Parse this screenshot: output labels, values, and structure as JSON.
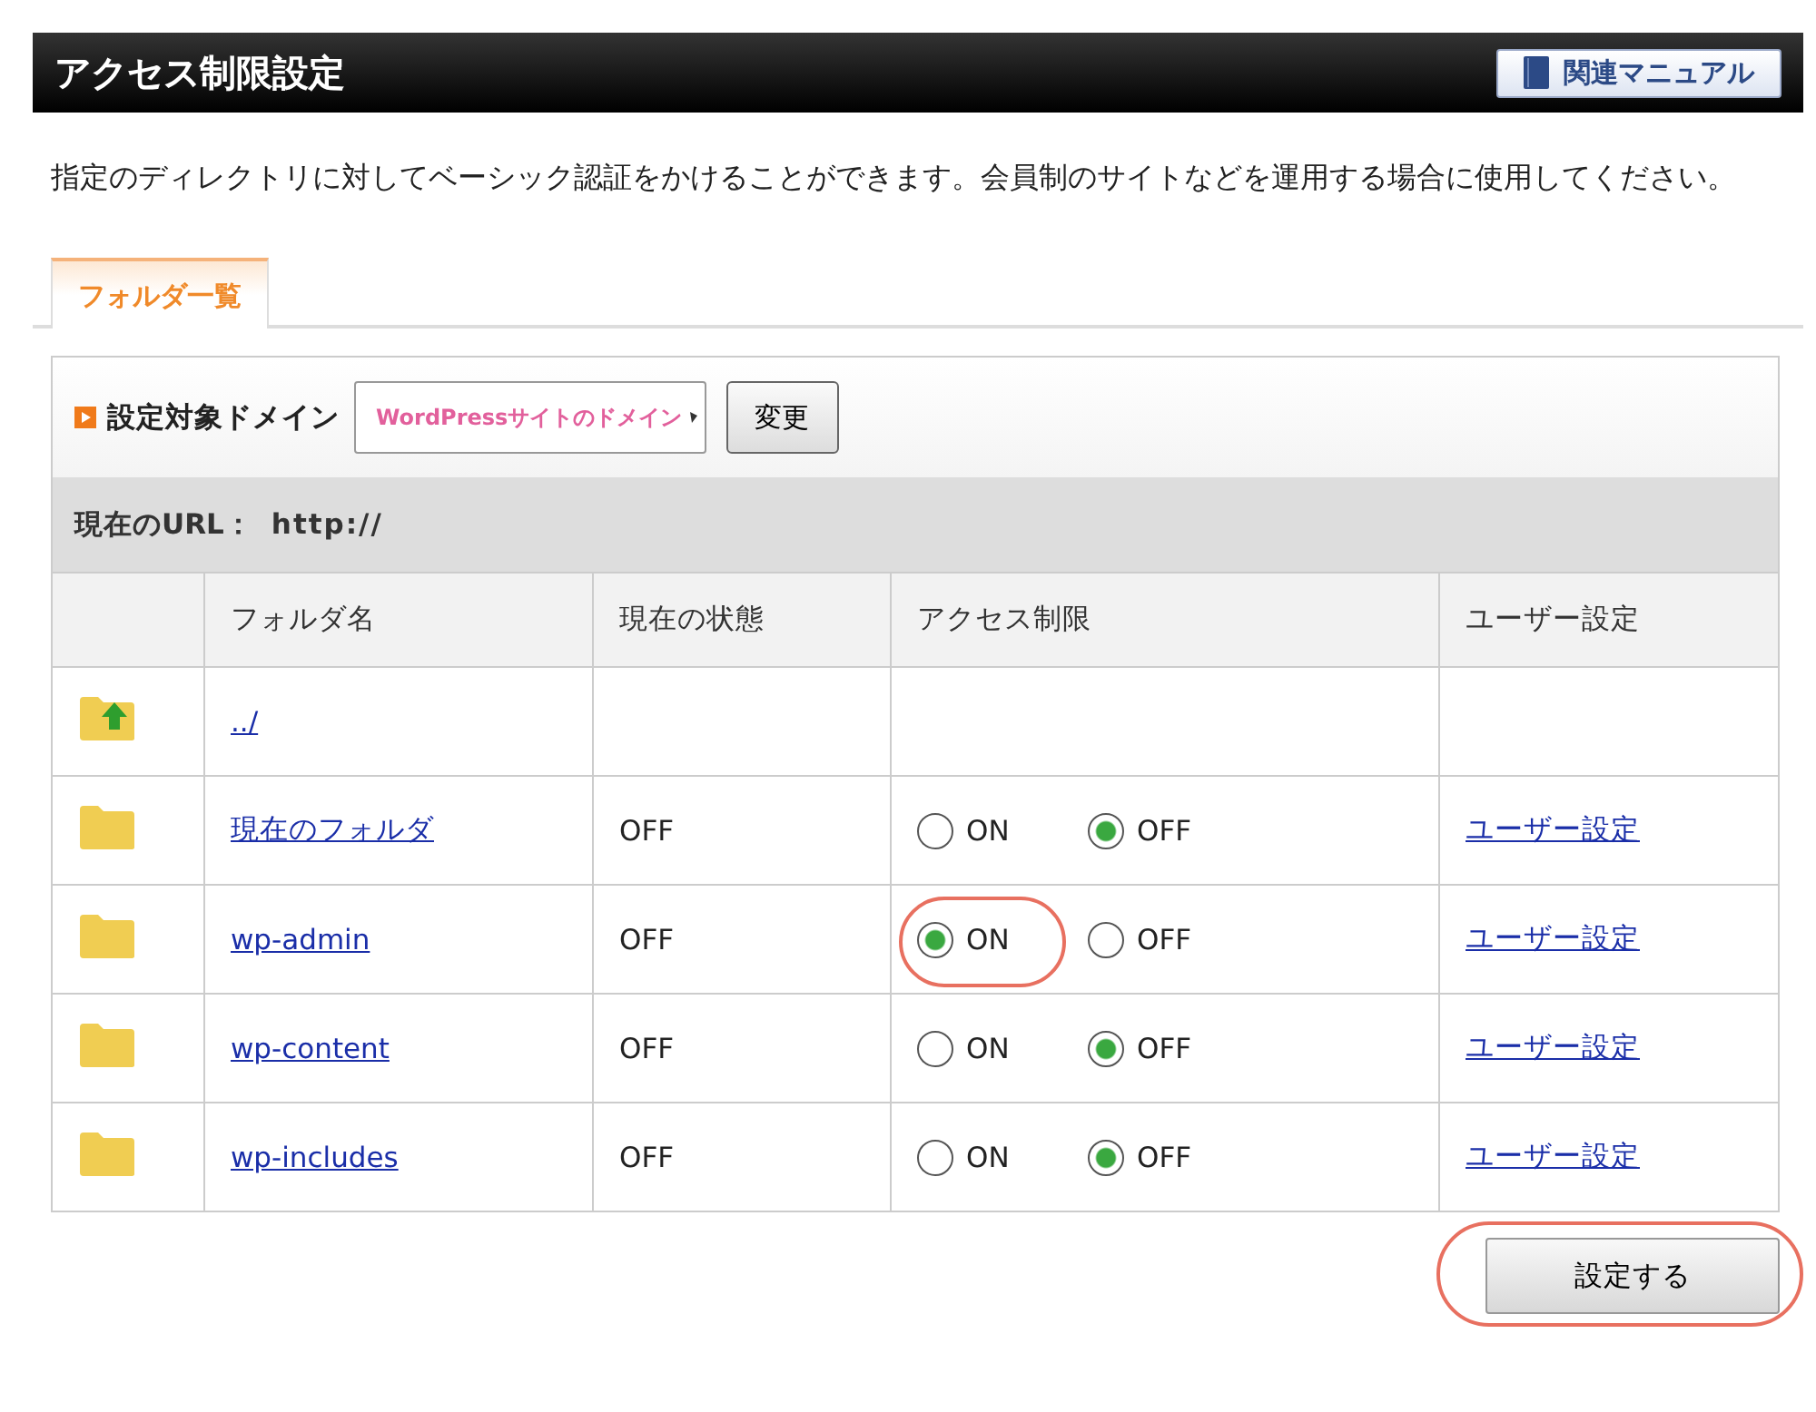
{
  "header": {
    "title": "アクセス制限設定",
    "manual_button": "関連マニュアル"
  },
  "description": "指定のディレクトリに対してベーシック認証をかけることができます。会員制のサイトなどを運用する場合に使用してください。",
  "tabs": [
    {
      "label": "フォルダ一覧",
      "selected": true
    }
  ],
  "domain": {
    "label": "設定対象ドメイン",
    "select_value": "WordPressサイトのドメイン",
    "change_button": "変更"
  },
  "current_url": {
    "label": "現在のURL：",
    "value": "http://"
  },
  "table": {
    "columns": [
      "フォルダ名",
      "現在の状態",
      "アクセス制限",
      "ユーザー設定"
    ],
    "rows": [
      {
        "kind": "parent",
        "name": "../"
      },
      {
        "kind": "folder",
        "name": "現在のフォルダ",
        "status": "OFF",
        "options": [
          {
            "label": "ON",
            "selected": false,
            "highlighted": false
          },
          {
            "label": "OFF",
            "selected": true,
            "highlighted": false
          }
        ],
        "user_link": "ユーザー設定"
      },
      {
        "kind": "folder",
        "name": "wp-admin",
        "status": "OFF",
        "options": [
          {
            "label": "ON",
            "selected": true,
            "highlighted": true
          },
          {
            "label": "OFF",
            "selected": false,
            "highlighted": false
          }
        ],
        "user_link": "ユーザー設定"
      },
      {
        "kind": "folder",
        "name": "wp-content",
        "status": "OFF",
        "options": [
          {
            "label": "ON",
            "selected": false,
            "highlighted": false
          },
          {
            "label": "OFF",
            "selected": true,
            "highlighted": false
          }
        ],
        "user_link": "ユーザー設定"
      },
      {
        "kind": "folder",
        "name": "wp-includes",
        "status": "OFF",
        "options": [
          {
            "label": "ON",
            "selected": false,
            "highlighted": false
          },
          {
            "label": "OFF",
            "selected": true,
            "highlighted": false
          }
        ],
        "user_link": "ユーザー設定"
      }
    ]
  },
  "submit": {
    "label": "設定する",
    "highlighted": true
  }
}
